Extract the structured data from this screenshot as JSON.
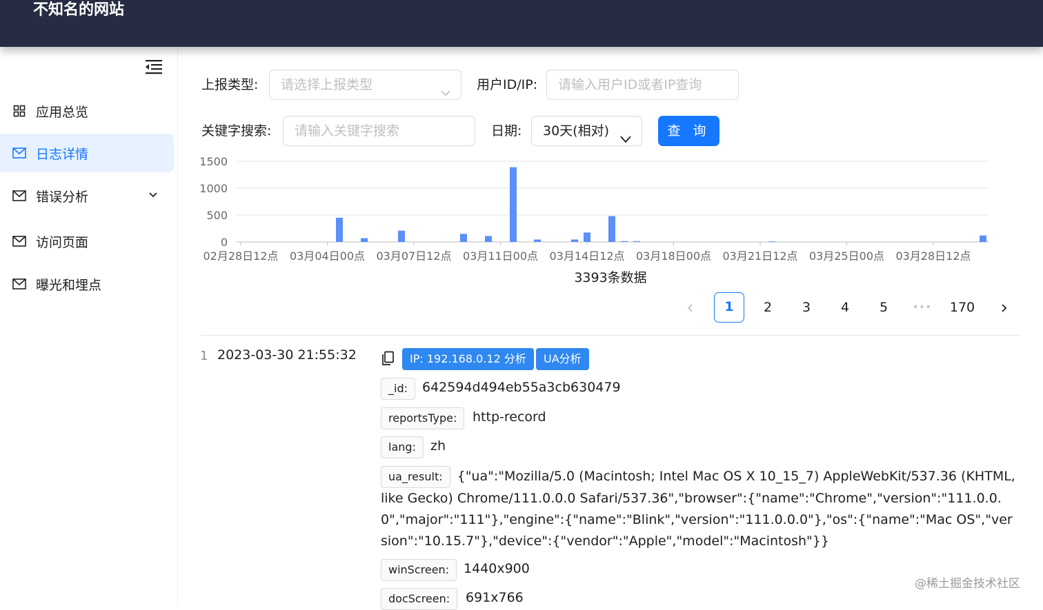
{
  "header": {
    "title": "不知名的网站"
  },
  "sidebar": {
    "items": [
      {
        "label": "应用总览",
        "icon": "grid-icon"
      },
      {
        "label": "日志详情",
        "icon": "mail-icon",
        "active": true
      },
      {
        "label": "错误分析",
        "icon": "mail-icon",
        "expandable": true
      },
      {
        "label": "访问页面",
        "icon": "mail-icon"
      },
      {
        "label": "曝光和埋点",
        "icon": "mail-icon"
      }
    ]
  },
  "filters": {
    "report_type_label": "上报类型:",
    "report_type_placeholder": "请选择上报类型",
    "user_label": "用户ID/IP:",
    "user_placeholder": "请输入用户ID或者IP查询",
    "keyword_label": "关键字搜索:",
    "keyword_placeholder": "请输入关键字搜索",
    "date_label": "日期:",
    "date_value": "30天(相对)",
    "query_button": "查 询"
  },
  "chart_data": {
    "type": "bar",
    "x_tick_labels": [
      "02月28日12点",
      "03月04日00点",
      "03月07日12点",
      "03月11日00点",
      "03月14日12点",
      "03月18日00点",
      "03月21日12点",
      "03月25日00点",
      "03月28日12点"
    ],
    "y_tick_labels": [
      "1500",
      "1000",
      "500",
      "0"
    ],
    "ylim": [
      0,
      1500
    ],
    "bars": [
      {
        "slot": 1,
        "value": 450
      },
      {
        "slot": 2,
        "value": 70
      },
      {
        "slot": 3,
        "value": 210
      },
      {
        "slot": 4,
        "value": 150
      },
      {
        "slot": 5,
        "value": 110
      },
      {
        "slot": 6,
        "value": 1390
      },
      {
        "slot": 7,
        "value": 45
      },
      {
        "slot": 8,
        "value": 45
      },
      {
        "slot": 9,
        "value": 175
      },
      {
        "slot": 10,
        "value": 480
      },
      {
        "slot": 11,
        "value": 15
      },
      {
        "slot": 12,
        "value": 15
      },
      {
        "slot": 13,
        "value": 10
      },
      {
        "slot": 14,
        "value": 120
      }
    ],
    "bar_color": "#5b8ff9",
    "caption": "3393条数据",
    "grid": true
  },
  "pagination": {
    "pages": [
      "1",
      "2",
      "3",
      "4",
      "5"
    ],
    "ellipsis": "•••",
    "last_page": "170",
    "current": "1"
  },
  "log": {
    "index": "1",
    "time": "2023-03-30 21:55:32",
    "ip_button": "IP: 192.168.0.12 分析",
    "ua_button": "UA分析",
    "fields": [
      {
        "key": "_id:",
        "value": "642594d494eb55a3cb630479"
      },
      {
        "key": "reportsType:",
        "value": "http-record"
      },
      {
        "key": "lang:",
        "value": "zh"
      }
    ],
    "ua_key": "ua_result:",
    "ua_value": "{\"ua\":\"Mozilla/5.0 (Macintosh; Intel Mac OS X 10_15_7) AppleWebKit/537.36 (KHTML, like Gecko) Chrome/111.0.0.0 Safari/537.36\",\"browser\":{\"name\":\"Chrome\",\"version\":\"111.0.0.0\",\"major\":\"111\"},\"engine\":{\"name\":\"Blink\",\"version\":\"111.0.0.0\"},\"os\":{\"name\":\"Mac OS\",\"version\":\"10.15.7\"},\"device\":{\"vendor\":\"Apple\",\"model\":\"Macintosh\"}}",
    "win_key": "winScreen:",
    "win_value": "1440x900",
    "doc_key": "docScreen:",
    "doc_value": "691x766"
  },
  "watermark": "@稀土掘金技术社区"
}
